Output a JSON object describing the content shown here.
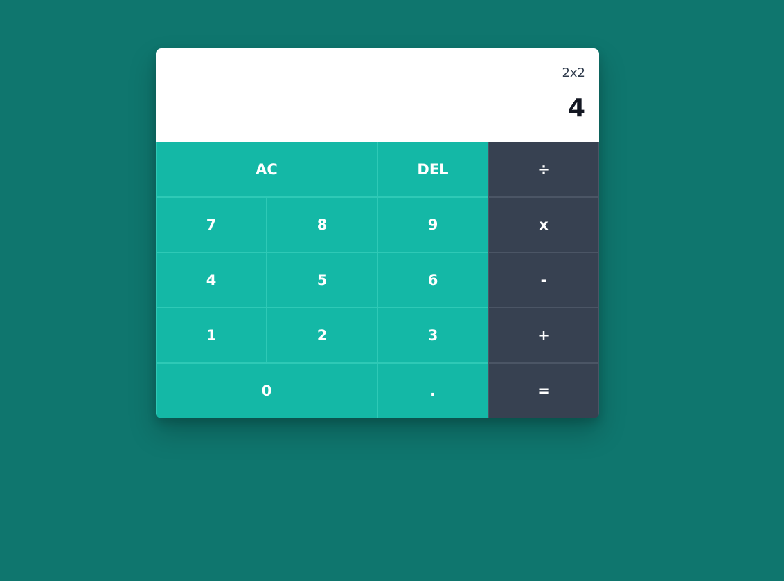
{
  "display": {
    "previous_operand": "2x2",
    "current_operand": "4"
  },
  "keys": {
    "clear": "AC",
    "delete": "DEL",
    "divide": "÷",
    "seven": "7",
    "eight": "8",
    "nine": "9",
    "multiply": "x",
    "four": "4",
    "five": "5",
    "six": "6",
    "subtract": "-",
    "one": "1",
    "two": "2",
    "three": "3",
    "add": "+",
    "zero": "0",
    "decimal": ".",
    "equals": "="
  },
  "colors": {
    "page_background": "#0f766e",
    "display_background": "#ffffff",
    "number_key": "#14b8a6",
    "operator_key": "#374151",
    "key_text": "#ffffff"
  }
}
